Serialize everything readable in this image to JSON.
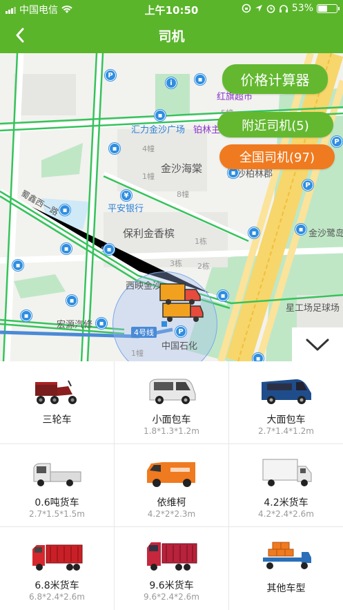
{
  "status_bar": {
    "carrier": "中国电信",
    "time": "上午10:50",
    "battery": "53%",
    "battery_level": 0.53
  },
  "nav": {
    "back_icon": "chevron-left-icon",
    "title": "司机"
  },
  "map": {
    "labels": {
      "hongqi": "红旗超市",
      "huili": "汇力金沙广场",
      "bolin": "铂林主题酒店",
      "jinsha_haitang": "金沙海棠",
      "jinsha_bolin": "金沙柏林郡",
      "pingan": "平安银行",
      "baoli": "保利金香槟",
      "xiying": "西映金沙",
      "hongyuan": "宏源汽修",
      "sinopec": "中国石化",
      "xinggong": "星工场足球场",
      "jinsha_lu": "金沙鹭岛",
      "road": "蜀鑫西一路",
      "line4": "4号线",
      "b5": "5幢",
      "b4": "4幢",
      "b1": "1幢",
      "b8": "8幢",
      "b5b": "5幢",
      "b1b": "1栋",
      "b3": "3栋",
      "b2": "2栋",
      "b1c": "1幢",
      "b1d": "1幢"
    },
    "buttons": {
      "price_calc": "价格计算器",
      "nearby": "附近司机(5)",
      "national": "全国司机(97)"
    },
    "colors": {
      "price_calc": "#63b830",
      "nearby": "#63b830",
      "national": "#f07a1f"
    },
    "collapse_icon": "chevron-down-icon"
  },
  "vehicles": [
    {
      "name": "三轮车",
      "dims": ""
    },
    {
      "name": "小面包车",
      "dims": "1.8*1.3*1.2m"
    },
    {
      "name": "大面包车",
      "dims": "2.7*1.4*1.2m"
    },
    {
      "name": "0.6吨货车",
      "dims": "2.7*1.5*1.5m"
    },
    {
      "name": "依维柯",
      "dims": "4.2*2*2.3m"
    },
    {
      "name": "4.2米货车",
      "dims": "4.2*2.4*2.6m"
    },
    {
      "name": "6.8米货车",
      "dims": "6.8*2.4*2.6m"
    },
    {
      "name": "9.6米货车",
      "dims": "9.6*2.4*2.6m"
    },
    {
      "name": "其他车型",
      "dims": ""
    }
  ],
  "theme": {
    "primary": "#5ab52a",
    "accent": "#f07a1f"
  }
}
